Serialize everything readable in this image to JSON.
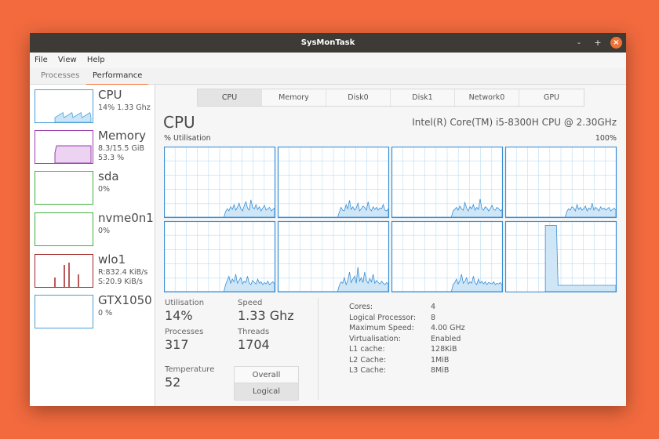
{
  "window": {
    "title": "SysMonTask"
  },
  "titlebar": {
    "minimize": "-",
    "maximize": "+",
    "close": "×"
  },
  "menu": [
    "File",
    "View",
    "Help"
  ],
  "top_tabs": [
    {
      "label": "Processes",
      "active": false
    },
    {
      "label": "Performance",
      "active": true
    }
  ],
  "sidebar": {
    "items": [
      {
        "name": "CPU",
        "lines": [
          "14% 1.33 Ghz"
        ],
        "color": "#4a9fd8",
        "fill": "#c9e5f7",
        "type": "cpu"
      },
      {
        "name": "Memory",
        "lines": [
          "8.3/15.5 GiB",
          "53.3 %"
        ],
        "color": "#9b3fae",
        "fill": "#ecd3f1",
        "type": "memory"
      },
      {
        "name": "sda",
        "lines": [
          "0%"
        ],
        "color": "#3fae3f",
        "fill": "#d7f2d7",
        "type": "flat"
      },
      {
        "name": "nvme0n1",
        "lines": [
          "0%"
        ],
        "color": "#3fae3f",
        "fill": "#d7f2d7",
        "type": "flat"
      },
      {
        "name": "wlo1",
        "lines": [
          "R:832.4 KiB/s",
          "S:20.9 KiB/s"
        ],
        "color": "#a02424",
        "fill": "#f4d4d4",
        "type": "net"
      },
      {
        "name": "GTX1050",
        "lines": [
          "0 %"
        ],
        "color": "#4a9fd8",
        "fill": "#c9e5f7",
        "type": "flat"
      }
    ]
  },
  "perf_tabs": [
    {
      "label": "CPU",
      "active": true
    },
    {
      "label": "Memory",
      "active": false
    },
    {
      "label": "Disk0",
      "active": false
    },
    {
      "label": "Disk1",
      "active": false
    },
    {
      "label": "Network0",
      "active": false
    },
    {
      "label": "GPU",
      "active": false
    }
  ],
  "cpu": {
    "title": "CPU",
    "model": "Intel(R) Core(TM) i5-8300H CPU @ 2.30GHz",
    "util_label": "% Utilisation",
    "util_max": "100%",
    "graph_color": "#3a8fd6",
    "graph_fill": "#cfe6f7",
    "grid_color": "#bcdcf2",
    "core_levels": [
      [
        0,
        0,
        0,
        0,
        0,
        0,
        0,
        0,
        0,
        0,
        0,
        0,
        0,
        0,
        0,
        0,
        0,
        0,
        0,
        0,
        0,
        0,
        0,
        0,
        0,
        0,
        0,
        0,
        0,
        0,
        0,
        0,
        0,
        0,
        0,
        0,
        8,
        12,
        9,
        15,
        11,
        18,
        10,
        14,
        20,
        12,
        9,
        16,
        22,
        13,
        10,
        25,
        14,
        12,
        18,
        11,
        15,
        9,
        13,
        17,
        10,
        12,
        14,
        9,
        11,
        13
      ],
      [
        0,
        0,
        0,
        0,
        0,
        0,
        0,
        0,
        0,
        0,
        0,
        0,
        0,
        0,
        0,
        0,
        0,
        0,
        0,
        0,
        0,
        0,
        0,
        0,
        0,
        0,
        0,
        0,
        0,
        0,
        0,
        0,
        0,
        0,
        0,
        0,
        7,
        14,
        10,
        9,
        18,
        12,
        24,
        11,
        15,
        10,
        13,
        20,
        9,
        12,
        16,
        14,
        10,
        22,
        12,
        9,
        15,
        11,
        14,
        10,
        13,
        12,
        18,
        10,
        9,
        12
      ],
      [
        0,
        0,
        0,
        0,
        0,
        0,
        0,
        0,
        0,
        0,
        0,
        0,
        0,
        0,
        0,
        0,
        0,
        0,
        0,
        0,
        0,
        0,
        0,
        0,
        0,
        0,
        0,
        0,
        0,
        0,
        0,
        0,
        0,
        0,
        0,
        0,
        9,
        11,
        14,
        10,
        16,
        12,
        10,
        21,
        13,
        9,
        15,
        12,
        18,
        10,
        14,
        11,
        26,
        12,
        10,
        15,
        13,
        9,
        12,
        17,
        11,
        10,
        14,
        12,
        9,
        11
      ],
      [
        0,
        0,
        0,
        0,
        0,
        0,
        0,
        0,
        0,
        0,
        0,
        0,
        0,
        0,
        0,
        0,
        0,
        0,
        0,
        0,
        0,
        0,
        0,
        0,
        0,
        0,
        0,
        0,
        0,
        0,
        0,
        0,
        0,
        0,
        0,
        0,
        8,
        12,
        10,
        15,
        13,
        9,
        18,
        11,
        14,
        10,
        12,
        16,
        9,
        13,
        11,
        20,
        10,
        14,
        12,
        9,
        15,
        11,
        13,
        10,
        12,
        14,
        9,
        11,
        13,
        10
      ],
      [
        0,
        0,
        0,
        0,
        0,
        0,
        0,
        0,
        0,
        0,
        0,
        0,
        0,
        0,
        0,
        0,
        0,
        0,
        0,
        0,
        0,
        0,
        0,
        0,
        0,
        0,
        0,
        0,
        0,
        0,
        0,
        0,
        0,
        0,
        0,
        0,
        10,
        16,
        22,
        12,
        18,
        14,
        25,
        12,
        16,
        20,
        11,
        15,
        13,
        22,
        12,
        10,
        16,
        13,
        11,
        18,
        12,
        14,
        10,
        13,
        11,
        15,
        10,
        12,
        14,
        11
      ],
      [
        0,
        0,
        0,
        0,
        0,
        0,
        0,
        0,
        0,
        0,
        0,
        0,
        0,
        0,
        0,
        0,
        0,
        0,
        0,
        0,
        0,
        0,
        0,
        0,
        0,
        0,
        0,
        0,
        0,
        0,
        0,
        0,
        0,
        0,
        0,
        0,
        9,
        14,
        12,
        20,
        10,
        16,
        28,
        13,
        18,
        22,
        12,
        35,
        15,
        20,
        13,
        28,
        16,
        12,
        19,
        14,
        25,
        12,
        16,
        13,
        11,
        15,
        12,
        10,
        13,
        11
      ],
      [
        0,
        0,
        0,
        0,
        0,
        0,
        0,
        0,
        0,
        0,
        0,
        0,
        0,
        0,
        0,
        0,
        0,
        0,
        0,
        0,
        0,
        0,
        0,
        0,
        0,
        0,
        0,
        0,
        0,
        0,
        0,
        0,
        0,
        0,
        0,
        0,
        10,
        13,
        18,
        11,
        16,
        25,
        12,
        15,
        20,
        11,
        14,
        12,
        22,
        13,
        10,
        18,
        12,
        15,
        11,
        14,
        10,
        13,
        12,
        11,
        14,
        10,
        12,
        11,
        13,
        10
      ],
      [
        0,
        0,
        0,
        0,
        0,
        0,
        0,
        0,
        0,
        0,
        0,
        0,
        0,
        0,
        0,
        0,
        0,
        0,
        0,
        0,
        0,
        0,
        0,
        0,
        0,
        0,
        0,
        0,
        0,
        0,
        0,
        0,
        0,
        0,
        0,
        0,
        0,
        0,
        0,
        0,
        0,
        0,
        0,
        0,
        0,
        0,
        0,
        0,
        0,
        0,
        0,
        0,
        0,
        0,
        0,
        0,
        0,
        0,
        0,
        0,
        0,
        0,
        0,
        0,
        0,
        0
      ]
    ],
    "core8_spike": {
      "from": 0.36,
      "to": 0.46,
      "level": 95
    },
    "stats": {
      "utilisation": {
        "label": "Utilisation",
        "value": "14%"
      },
      "speed": {
        "label": "Speed",
        "value": "1.33 Ghz"
      },
      "processes": {
        "label": "Processes",
        "value": "317"
      },
      "threads": {
        "label": "Threads",
        "value": "1704"
      },
      "temperature": {
        "label": "Temperature",
        "value": "52"
      }
    },
    "toggle": {
      "overall": "Overall",
      "logical": "Logical"
    },
    "info": [
      {
        "k": "Cores:",
        "v": "4"
      },
      {
        "k": "Logical Processor:",
        "v": "8"
      },
      {
        "k": "Maximum Speed:",
        "v": "4.00 GHz"
      },
      {
        "k": "Virtualisation:",
        "v": "Enabled"
      },
      {
        "k": "L1 cache:",
        "v": "128KiB"
      },
      {
        "k": "L2 Cache:",
        "v": "1MiB"
      },
      {
        "k": "L3 Cache:",
        "v": "8MiB"
      }
    ]
  }
}
